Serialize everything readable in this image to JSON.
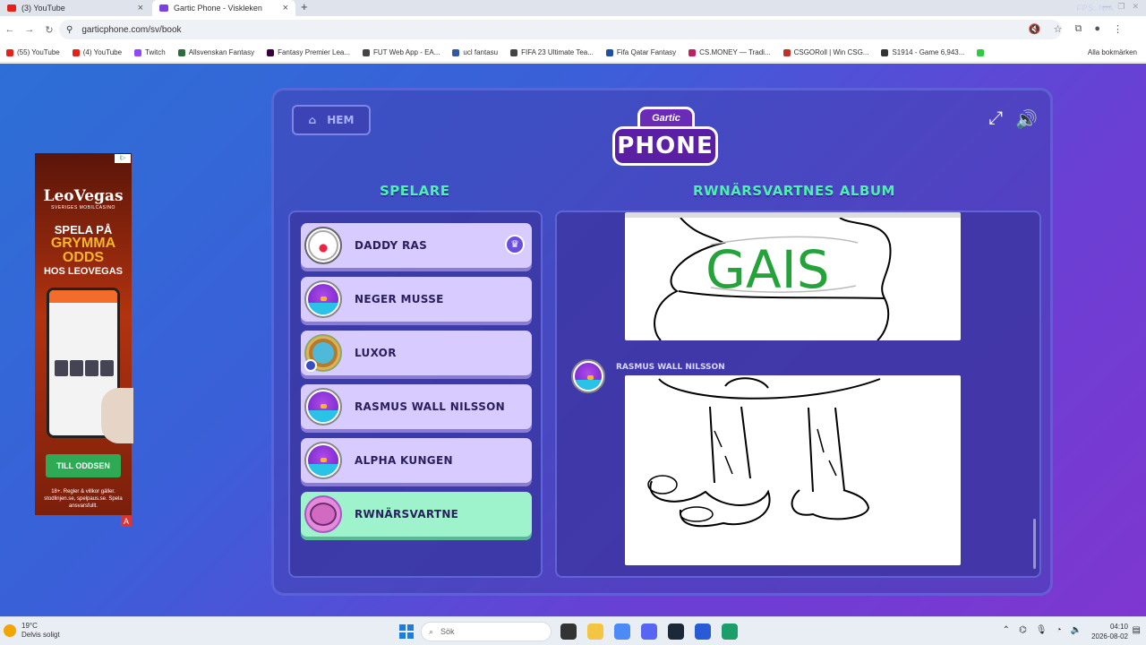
{
  "browser": {
    "tabs": [
      {
        "label": "(3) YouTube",
        "active": false
      },
      {
        "label": "Gartic Phone - Viskleken",
        "active": true
      }
    ],
    "new_tab": "+",
    "fps_overlay": "FPS: N/A",
    "url": "garticphone.com/sv/book",
    "bookmarks": [
      {
        "label": "(55) YouTube",
        "color": "#e62117"
      },
      {
        "label": "(4) YouTube",
        "color": "#e62117"
      },
      {
        "label": "Twitch",
        "color": "#9146ff"
      },
      {
        "label": "Allsvenskan Fantasy",
        "color": "#2d6a3e"
      },
      {
        "label": "Fantasy Premier Lea...",
        "color": "#37003c"
      },
      {
        "label": "FUT Web App - EA...",
        "color": "#444444"
      },
      {
        "label": "ucl fantasu",
        "color": "#3355aa"
      },
      {
        "label": "FIFA 23 Ultimate Tea...",
        "color": "#444444"
      },
      {
        "label": "Fifa Qatar Fantasy",
        "color": "#1d4fa8"
      },
      {
        "label": "CS.MONEY — Tradi...",
        "color": "#c02060"
      },
      {
        "label": "CSGORoll | Win CSG...",
        "color": "#c0302a"
      },
      {
        "label": "S1914 - Game 6,943...",
        "color": "#333333"
      },
      {
        "label": "",
        "color": "#2ecc40"
      }
    ],
    "all_bookmarks": "Alla bokmärken"
  },
  "ad": {
    "brand": "LeoVegas",
    "tagline": "SVERIGES MOBILCASINO",
    "headline1": "SPELA PÅ",
    "headline2a": "GRYMMA",
    "headline2b": "ODDS",
    "headline3": "HOS LEOVEGAS",
    "cta": "TILL ODDSEN",
    "legal": "18+. Regler & villkor gäller. stodlinjen.se, spelpaus.se. Spela ansvarsfullt.",
    "badge": "i▷",
    "corner": "A"
  },
  "game": {
    "home_label": "HEM",
    "logo_top": "Gartic",
    "logo_bottom": "PHONE",
    "players_title": "SPELARE",
    "album_title": "RWNÄRSVARTNES ALBUM",
    "players": [
      {
        "name": "DADDY RAS",
        "avatar": "clown-icon",
        "host": true,
        "me": false
      },
      {
        "name": "NEGER MUSSE",
        "avatar": "bird-icon",
        "host": false,
        "me": false
      },
      {
        "name": "LUXOR",
        "avatar": "lion-icon",
        "host": false,
        "me": false
      },
      {
        "name": "RASMUS WALL NILSSON",
        "avatar": "bird-icon",
        "host": false,
        "me": false
      },
      {
        "name": "ALPHA KUNGEN",
        "avatar": "bird-icon",
        "host": false,
        "me": false
      },
      {
        "name": "RWNÄRSVARTNE",
        "avatar": "monster-icon",
        "host": false,
        "me": true
      }
    ],
    "album": {
      "drawing1_text": "GAIS",
      "drawing2_author": "RASMUS WALL NILSSON"
    }
  },
  "taskbar": {
    "weather_temp": "19°C",
    "weather_desc": "Delvis soligt",
    "search_placeholder": "Sök",
    "time": "04:10",
    "date": "2026-08-02"
  }
}
